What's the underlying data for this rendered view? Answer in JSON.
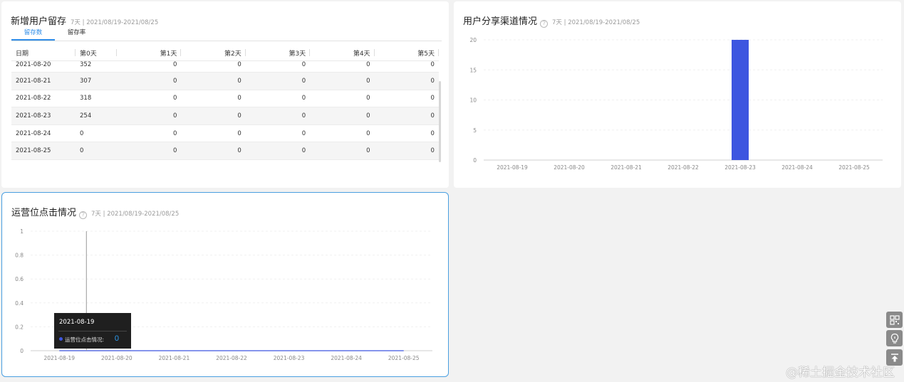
{
  "retention": {
    "title": "新增用户留存",
    "range": "7天 | 2021/08/19-2021/08/25",
    "tabs": [
      {
        "label": "留存数",
        "active": true
      },
      {
        "label": "留存率",
        "active": false
      }
    ],
    "columns": [
      "日期",
      "第0天",
      "第1天",
      "第2天",
      "第3天",
      "第4天",
      "第5天"
    ],
    "rows": [
      [
        "2021-08-20",
        "352",
        "0",
        "0",
        "0",
        "0",
        "0"
      ],
      [
        "2021-08-21",
        "307",
        "0",
        "0",
        "0",
        "0",
        "0"
      ],
      [
        "2021-08-22",
        "318",
        "0",
        "0",
        "0",
        "0",
        "0"
      ],
      [
        "2021-08-23",
        "254",
        "0",
        "0",
        "0",
        "0",
        "0"
      ],
      [
        "2021-08-24",
        "0",
        "0",
        "0",
        "0",
        "0",
        "0"
      ],
      [
        "2021-08-25",
        "0",
        "0",
        "0",
        "0",
        "0",
        "0"
      ]
    ]
  },
  "share": {
    "title": "用户分享渠道情况",
    "range": "7天 | 2021/08/19-2021/08/25"
  },
  "ops": {
    "title": "运营位点击情况",
    "range": "7天 | 2021/08/19-2021/08/25",
    "tooltip": {
      "date": "2021-08-19",
      "label": "运营位点击情况:",
      "value": "0"
    }
  },
  "chart_data": [
    {
      "type": "bar",
      "categories": [
        "2021-08-19",
        "2021-08-20",
        "2021-08-21",
        "2021-08-22",
        "2021-08-23",
        "2021-08-24",
        "2021-08-25"
      ],
      "values": [
        0,
        0,
        0,
        0,
        20,
        0,
        0
      ],
      "yticks": [
        0,
        5,
        10,
        15,
        20
      ],
      "ylim": [
        0,
        20
      ],
      "color": "#3d56e0",
      "grid": true
    },
    {
      "type": "line",
      "categories": [
        "2021-08-19",
        "2021-08-20",
        "2021-08-21",
        "2021-08-22",
        "2021-08-23",
        "2021-08-24",
        "2021-08-25"
      ],
      "values": [
        0,
        0,
        0,
        0,
        0,
        0,
        0
      ],
      "yticks": [
        0,
        0.2,
        0.4,
        0.6,
        0.8,
        1
      ],
      "ylim": [
        0,
        1
      ],
      "color": "#3d56e0",
      "grid": true
    }
  ],
  "sidebar_icons": [
    "qrcode-icon",
    "lightbulb-icon",
    "back-to-top-icon"
  ],
  "watermark": "@稀土掘金技术社区"
}
